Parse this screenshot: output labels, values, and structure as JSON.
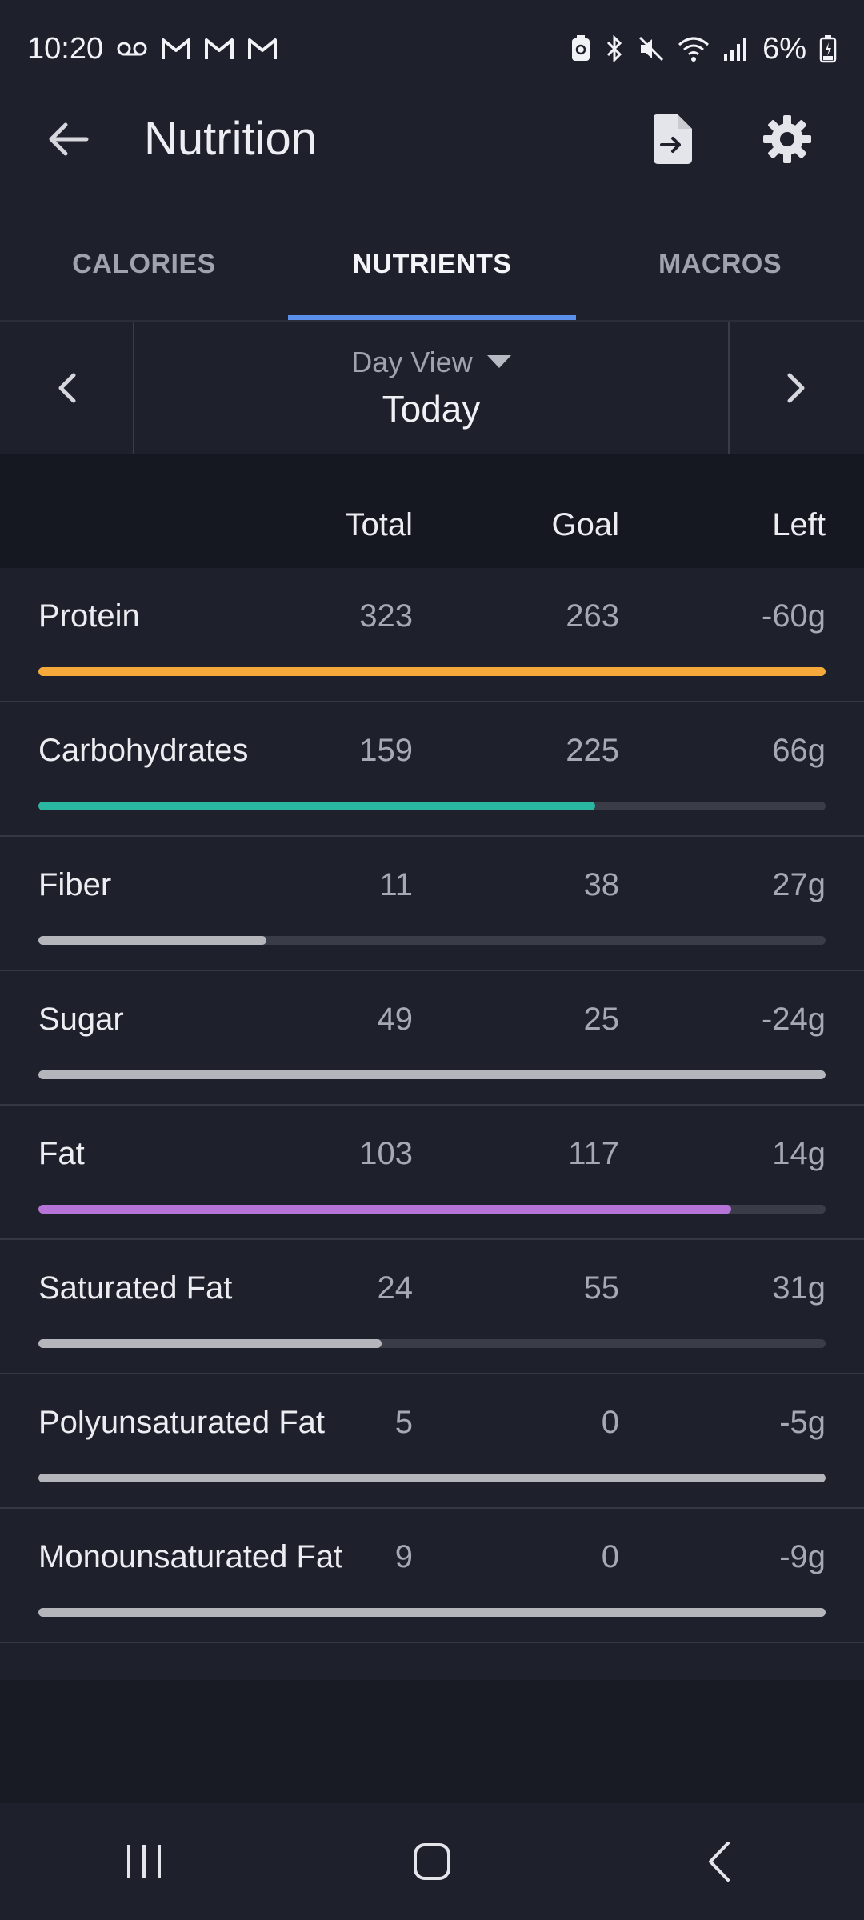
{
  "status_bar": {
    "time": "10:20",
    "battery": "6%",
    "left_icons": [
      "voicemail-icon",
      "gmail-icon",
      "gmail-icon",
      "gmail-icon"
    ],
    "right_icons": [
      "battery-saver-icon",
      "bluetooth-icon",
      "mute-icon",
      "wifi-icon",
      "signal-icon",
      "battery-icon"
    ]
  },
  "app_bar": {
    "title": "Nutrition",
    "icons": [
      "back-arrow-icon",
      "export-file-icon",
      "gear-icon"
    ]
  },
  "tabs": [
    {
      "label": "CALORIES",
      "active": false
    },
    {
      "label": "NUTRIENTS",
      "active": true
    },
    {
      "label": "MACROS",
      "active": false
    }
  ],
  "date_nav": {
    "view": "Day View",
    "date": "Today"
  },
  "columns": {
    "total": "Total",
    "goal": "Goal",
    "left": "Left"
  },
  "nutrients": [
    {
      "name": "Protein",
      "total": "323",
      "goal": "263",
      "left": "-60g",
      "progress": 1.0,
      "color": "#f5a93b"
    },
    {
      "name": "Carbohydrates",
      "total": "159",
      "goal": "225",
      "left": "66g",
      "progress": 0.707,
      "color": "#2bb8a3"
    },
    {
      "name": "Fiber",
      "total": "11",
      "goal": "38",
      "left": "27g",
      "progress": 0.29,
      "color": "#b5b6bb"
    },
    {
      "name": "Sugar",
      "total": "49",
      "goal": "25",
      "left": "-24g",
      "progress": 1.0,
      "color": "#b5b6bb"
    },
    {
      "name": "Fat",
      "total": "103",
      "goal": "117",
      "left": "14g",
      "progress": 0.88,
      "color": "#b674d8"
    },
    {
      "name": "Saturated Fat",
      "total": "24",
      "goal": "55",
      "left": "31g",
      "progress": 0.436,
      "color": "#b5b6bb"
    },
    {
      "name": "Polyunsaturated Fat",
      "total": "5",
      "goal": "0",
      "left": "-5g",
      "progress": 1.0,
      "color": "#b5b6bb"
    },
    {
      "name": "Monounsaturated Fat",
      "total": "9",
      "goal": "0",
      "left": "-9g",
      "progress": 1.0,
      "color": "#b5b6bb"
    }
  ],
  "nav_bar": {
    "icons": [
      "recents-icon",
      "home-icon",
      "back-icon"
    ]
  }
}
